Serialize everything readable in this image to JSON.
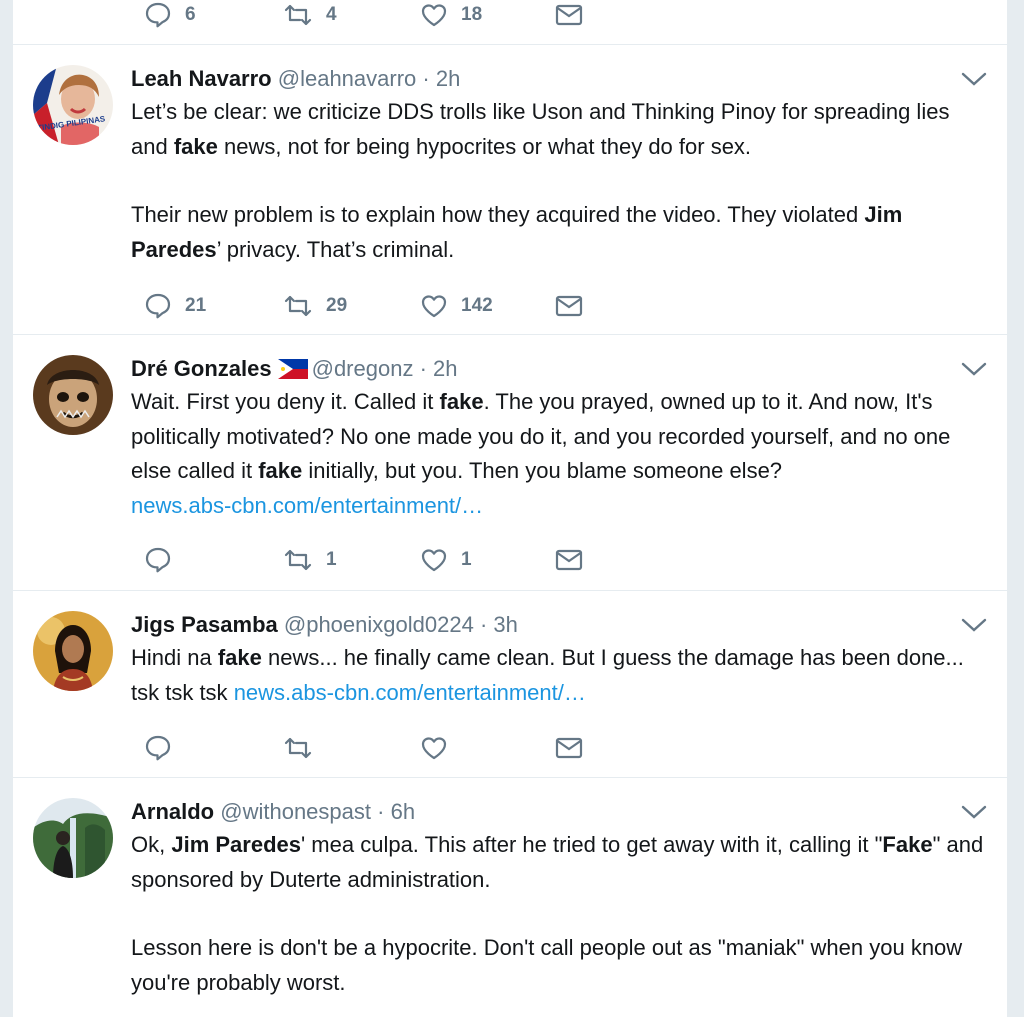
{
  "top_actions": {
    "replies": "6",
    "retweets": "4",
    "likes": "18"
  },
  "tweets": [
    {
      "name": "Leah Navarro",
      "handle": "@leahnavarro",
      "dot": "·",
      "time": "2h",
      "avatar_caption": "TINDIG PILIPINAS",
      "p1": [
        "Let’s be clear: we criticize DDS trolls like Uson and Thinking Pinoy for spreading lies and ",
        "fake",
        " news, not for being hypocrites or what they do for sex."
      ],
      "p2": [
        "Their new problem is to explain how they acquired the video. They violated ",
        "Jim Paredes",
        "’ privacy. That’s criminal."
      ],
      "replies": "21",
      "retweets": "29",
      "likes": "142"
    },
    {
      "name": "Dré Gonzales",
      "handle": "@dregonz",
      "dot": "·",
      "time": "2h",
      "p1": [
        "Wait. First you deny it. Called it ",
        "fake",
        ". The you prayed, owned up to it. And now, It's politically motivated? No one made you do it, and you recorded yourself, and no one else called it ",
        "fake",
        " initially, but you. Then you blame someone else?"
      ],
      "link": "news.abs-cbn.com/entertainment/…",
      "replies": "",
      "retweets": "1",
      "likes": "1"
    },
    {
      "name": "Jigs Pasamba",
      "handle": "@phoenixgold0224",
      "dot": "·",
      "time": "3h",
      "p1": [
        "Hindi na ",
        "fake",
        " news... he finally came clean. But I guess the damage has been done... tsk tsk tsk "
      ],
      "link": "news.abs-cbn.com/entertainment/…",
      "replies": "",
      "retweets": "",
      "likes": ""
    },
    {
      "name": "Arnaldo",
      "handle": "@withonespast",
      "dot": "·",
      "time": "6h",
      "p1": [
        "Ok, ",
        "Jim Paredes",
        "' mea culpa. This after he tried to get away with it, calling it \"",
        "Fake",
        "\" and sponsored by Duterte administration."
      ],
      "p2": [
        "Lesson here is don't be a hypocrite. Don't call people out as \"maniak\" when you know you're probably worst."
      ]
    }
  ],
  "colors": {
    "link": "#1b95e0",
    "muted": "#657786",
    "background": "#e6ecf0"
  }
}
